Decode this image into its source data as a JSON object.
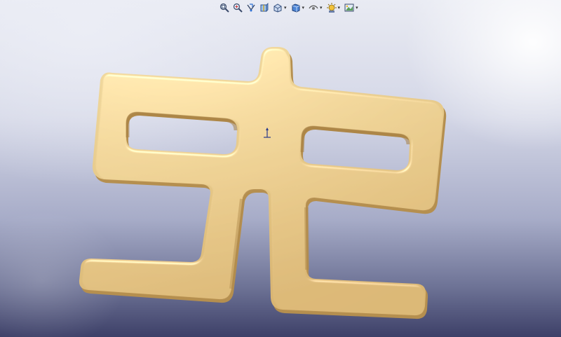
{
  "window": {
    "viewport": "graphics-area"
  },
  "toolbar": {
    "items": [
      {
        "icon": "zoom-to-fit-icon"
      },
      {
        "icon": "zoom-to-area-icon"
      },
      {
        "icon": "previous-view-icon"
      },
      {
        "icon": "section-view-icon"
      },
      {
        "icon": "view-orientation-icon",
        "dropdown": true
      },
      {
        "icon": "display-style-icon",
        "dropdown": true
      },
      {
        "icon": "hide-show-items-icon",
        "dropdown": true
      },
      {
        "icon": "edit-appearance-icon",
        "dropdown": true
      },
      {
        "icon": "apply-scene-icon",
        "dropdown": true
      }
    ]
  },
  "model": {
    "part_color": "#e6c98a",
    "part_shadow": "#b08a4c",
    "background_top": "#e9ebf3",
    "background_bottom": "#3d4068"
  }
}
